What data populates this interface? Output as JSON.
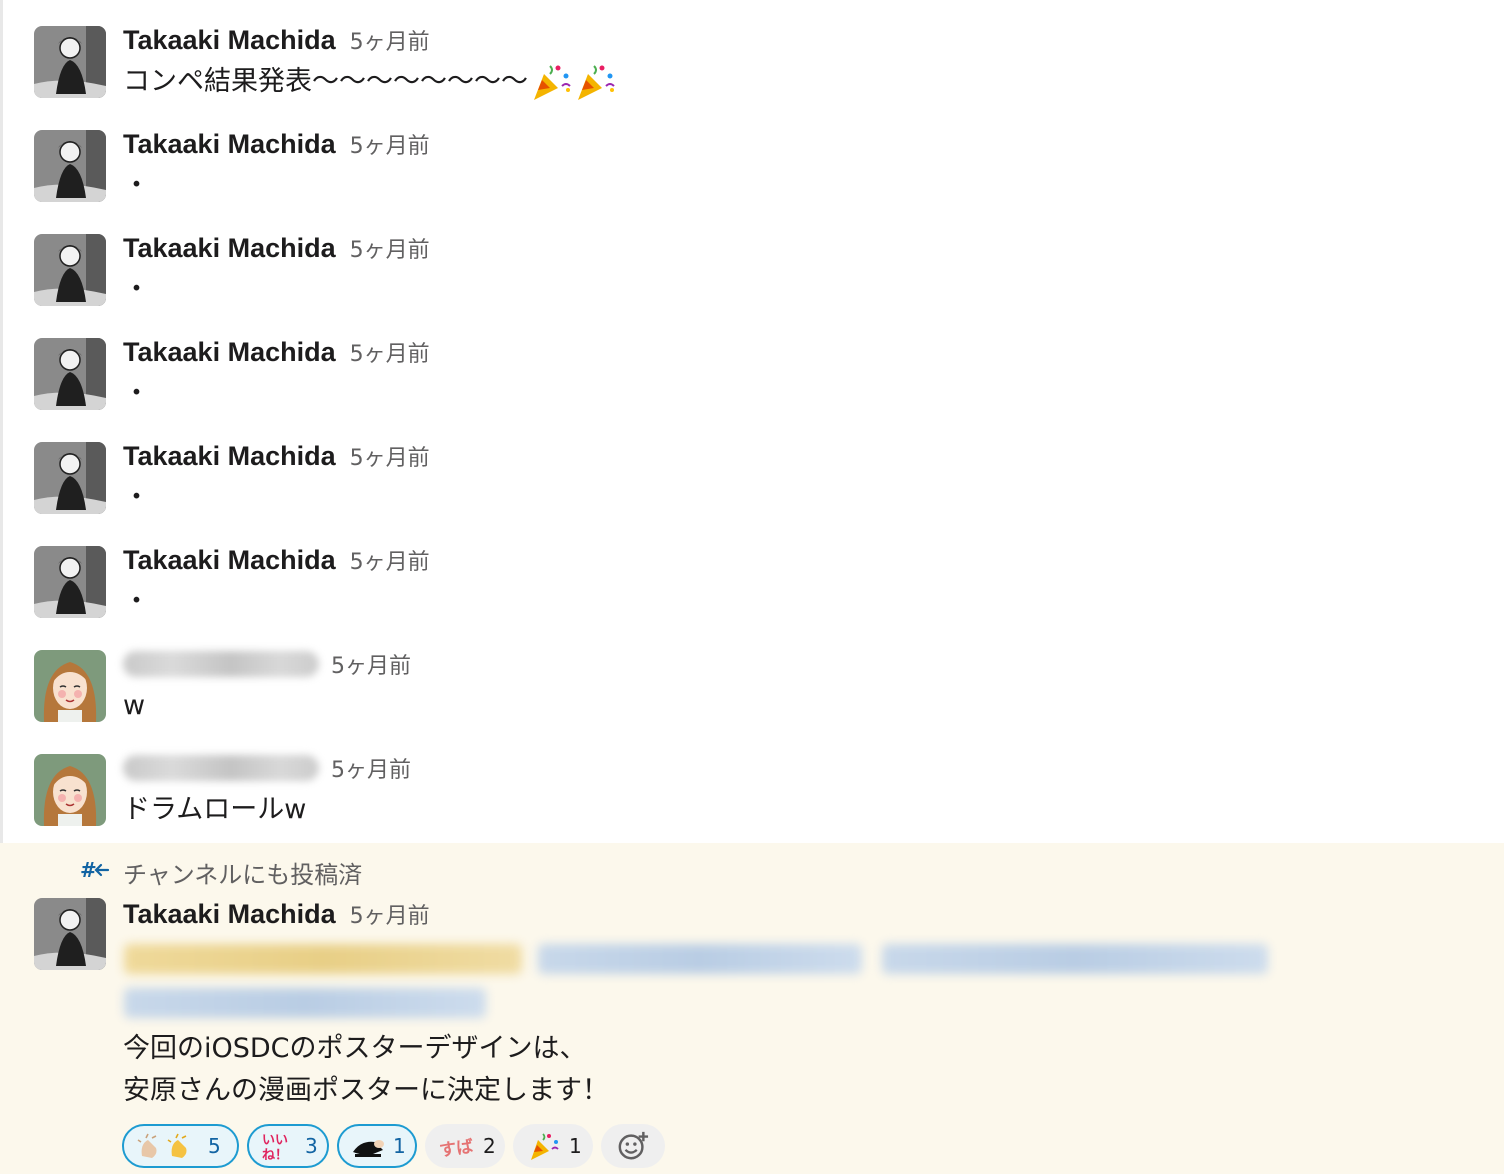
{
  "messages": [
    {
      "author": "Takaaki Machida",
      "time": "5ヶ月前",
      "text": "コンペ結果発表〜〜〜〜〜〜〜〜"
    },
    {
      "author": "Takaaki Machida",
      "time": "5ヶ月前",
      "text": "・"
    },
    {
      "author": "Takaaki Machida",
      "time": "5ヶ月前",
      "text": "・"
    },
    {
      "author": "Takaaki Machida",
      "time": "5ヶ月前",
      "text": "・"
    },
    {
      "author": "Takaaki Machida",
      "time": "5ヶ月前",
      "text": "・"
    },
    {
      "author": "Takaaki Machida",
      "time": "5ヶ月前",
      "text": "・"
    },
    {
      "author": "",
      "time": "5ヶ月前",
      "text": "w"
    },
    {
      "author": "",
      "time": "5ヶ月前",
      "text": "ドラムロールw"
    }
  ],
  "thread_note": "チャンネルにも投稿済",
  "last_message": {
    "author": "Takaaki Machida",
    "time": "5ヶ月前",
    "line1": "今回のiOSDCのポスターデザインは、",
    "line2": "安原さんの漫画ポスターに決定します！"
  },
  "reactions": [
    {
      "icon": "clap-icon",
      "count": "5",
      "mine": true
    },
    {
      "icon": "iine-icon",
      "count": "3",
      "mine": true
    },
    {
      "icon": "bow-icon",
      "count": "1",
      "mine": true
    },
    {
      "icon": "subarashii-icon",
      "count": "2",
      "mine": false
    },
    {
      "icon": "party-popper-icon",
      "count": "1",
      "mine": false
    }
  ],
  "colors": {
    "mention_highlight": "#efd99a",
    "mention_link": "#c8d8ea",
    "thread_bg": "#fcf8ec",
    "reaction_selected": "#1d9bd1"
  }
}
